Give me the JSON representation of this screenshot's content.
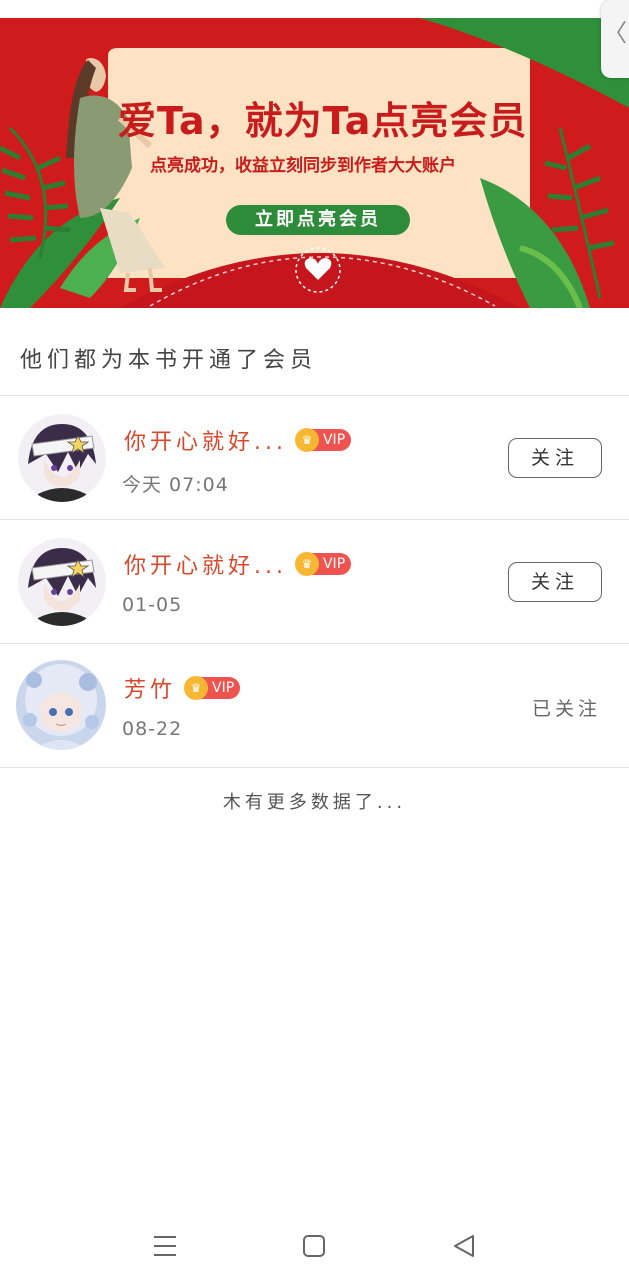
{
  "banner": {
    "title": "爱Ta，就为Ta点亮会员",
    "subtitle": "点亮成功，收益立刻同步到作者大大账户",
    "button_label": "立即点亮会员",
    "colors": {
      "background": "#cf1b1b",
      "card": "#fde3c3",
      "button": "#2e8b3a",
      "text": "#c81c1c"
    }
  },
  "side_tab": {
    "icon": "chevron-left-icon",
    "glyph": "〈"
  },
  "section_title": "他们都为本书开通了会员",
  "members": [
    {
      "name": "你开心就好...",
      "badge": "VIP",
      "time": "今天 07:04",
      "action": "关注",
      "followed": false,
      "avatar": "anime-boy-avatar"
    },
    {
      "name": "你开心就好...",
      "badge": "VIP",
      "time": "01-05",
      "action": "关注",
      "followed": false,
      "avatar": "anime-boy-avatar"
    },
    {
      "name": "芳竹",
      "badge": "VIP",
      "time": "08-22",
      "action": "已关注",
      "followed": true,
      "avatar": "anime-girl-avatar"
    }
  ],
  "footer_text": "木有更多数据了...",
  "navbar": {
    "items": [
      "menu-icon",
      "home-icon",
      "back-icon"
    ]
  },
  "colors": {
    "name": "#d9472b",
    "vip_badge": "#ef5350",
    "crown": "#f7b733"
  }
}
